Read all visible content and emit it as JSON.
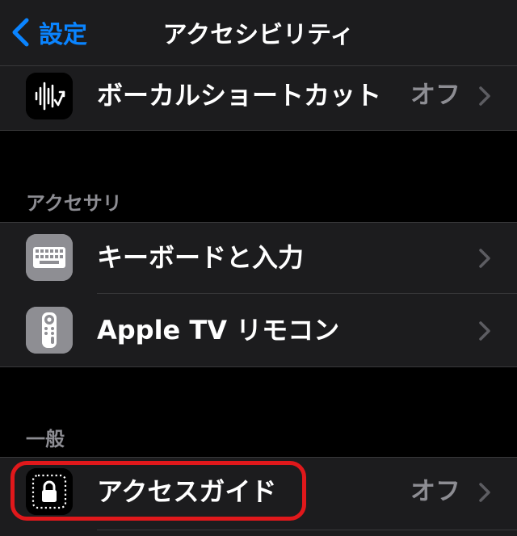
{
  "navbar": {
    "back_label": "設定",
    "title": "アクセシビリティ"
  },
  "group_top": {
    "row": {
      "label": "ボーカルショートカット",
      "value": "オフ",
      "icon": "waveform-arrow-icon"
    }
  },
  "section_accessories": {
    "header": "アクセサリ",
    "rows": [
      {
        "label": "キーボードと入力",
        "icon": "keyboard-icon"
      },
      {
        "label": "Apple TV リモコン",
        "icon": "tv-remote-icon"
      }
    ]
  },
  "section_general": {
    "header": "一般",
    "rows": [
      {
        "label": "アクセスガイド",
        "value": "オフ",
        "icon": "guided-access-lock-icon"
      }
    ]
  },
  "colors": {
    "accent": "#0a84ff",
    "highlight": "#e0181b",
    "cell_background": "#1c1c1e",
    "page_background": "#000000",
    "secondary_text": "#8d8d93"
  }
}
